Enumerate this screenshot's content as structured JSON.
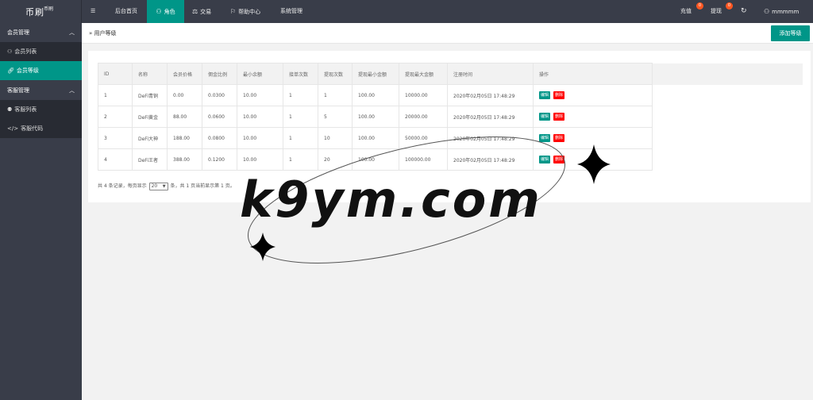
{
  "app": {
    "logo_text": "币刷",
    "logo_sub": "币刷"
  },
  "topnav": {
    "menu_icon": "☰",
    "items": [
      {
        "label": "后台首页",
        "icon": ""
      },
      {
        "label": "角色",
        "icon": "user-icon"
      },
      {
        "label": "交易",
        "icon": "scale-icon"
      },
      {
        "label": "帮助中心",
        "icon": "flag-icon"
      },
      {
        "label": "系统管理",
        "icon": ""
      }
    ],
    "recharge": {
      "label": "充值",
      "badge": "0"
    },
    "withdraw": {
      "label": "提现",
      "badge": "0"
    },
    "refresh_icon": "refresh-icon",
    "user": "mmmmm"
  },
  "sidebar": {
    "groups": [
      {
        "label": "会员管理",
        "items": [
          {
            "label": "会员列表"
          },
          {
            "label": "会员等级"
          }
        ]
      },
      {
        "label": "客服管理",
        "items": [
          {
            "label": "客服列表"
          },
          {
            "label": "客服代码"
          }
        ]
      }
    ]
  },
  "breadcrumb": {
    "label": "用户等级"
  },
  "toolbar": {
    "add_label": "添加等级"
  },
  "table": {
    "headers": [
      "ID",
      "名称",
      "会员价格",
      "佣金比例",
      "最小余额",
      "接单次数",
      "提现次数",
      "提现最小金额",
      "提现最大金额",
      "注册时间",
      "操作"
    ],
    "rows": [
      [
        "1",
        "DeFi青铜",
        "0.00",
        "0.0300",
        "10.00",
        "1",
        "1",
        "100.00",
        "10000.00",
        "2020年02月05日 17:48:29"
      ],
      [
        "2",
        "DeFi黄金",
        "88.00",
        "0.0600",
        "10.00",
        "1",
        "5",
        "100.00",
        "20000.00",
        "2020年02月05日 17:48:29"
      ],
      [
        "3",
        "DeFi大神",
        "188.00",
        "0.0800",
        "10.00",
        "1",
        "10",
        "100.00",
        "50000.00",
        "2020年02月05日 17:48:29"
      ],
      [
        "4",
        "DeFi王者",
        "388.00",
        "0.1200",
        "10.00",
        "1",
        "20",
        "100.00",
        "100000.00",
        "2020年02月05日 17:48:29"
      ]
    ],
    "edit_label": "编辑",
    "delete_label": "删除"
  },
  "pager": {
    "prefix": "共 4 条记录，每页显示",
    "page_size": "20",
    "suffix": "条，共 1 页当前显示第 1 页。"
  },
  "watermark": {
    "text": "k9ym.com"
  }
}
